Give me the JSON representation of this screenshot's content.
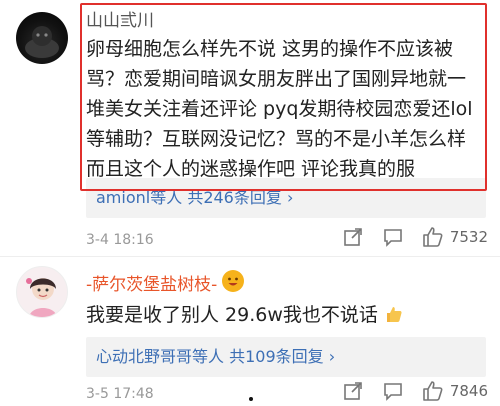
{
  "comments": [
    {
      "username": "山山弎川",
      "text": "卵母细胞怎么样先不说 这男的操作不应该被骂？恋爱期间暗讽女朋友胖出了国刚异地就一堆美女关注着还评论 pyq发期待校园恋爱还lol等辅助？互联网没记忆？骂的不是小羊怎么样而且这个人的迷惑操作吧 评论我真的服",
      "replies": {
        "who": "amionl等人",
        "count_text": "共246条回复",
        "arrow": "›"
      },
      "time": "3-4 18:16",
      "likes": "7532"
    },
    {
      "username": "-萨尔茨堡盐树枝-",
      "text": "我要是收了别人 29.6w我也不说话",
      "replies": {
        "who": "心动北野哥哥等人",
        "count_text": "共109条回复",
        "arrow": "›"
      },
      "time": "3-5 17:48",
      "likes": "7846"
    }
  ],
  "icons": {
    "share": "share-icon",
    "comment": "comment-icon",
    "like": "thumbs-up-icon"
  },
  "colors": {
    "highlight": "#e0302c",
    "link": "#3d6fb5",
    "username_accent": "#e8552a"
  }
}
